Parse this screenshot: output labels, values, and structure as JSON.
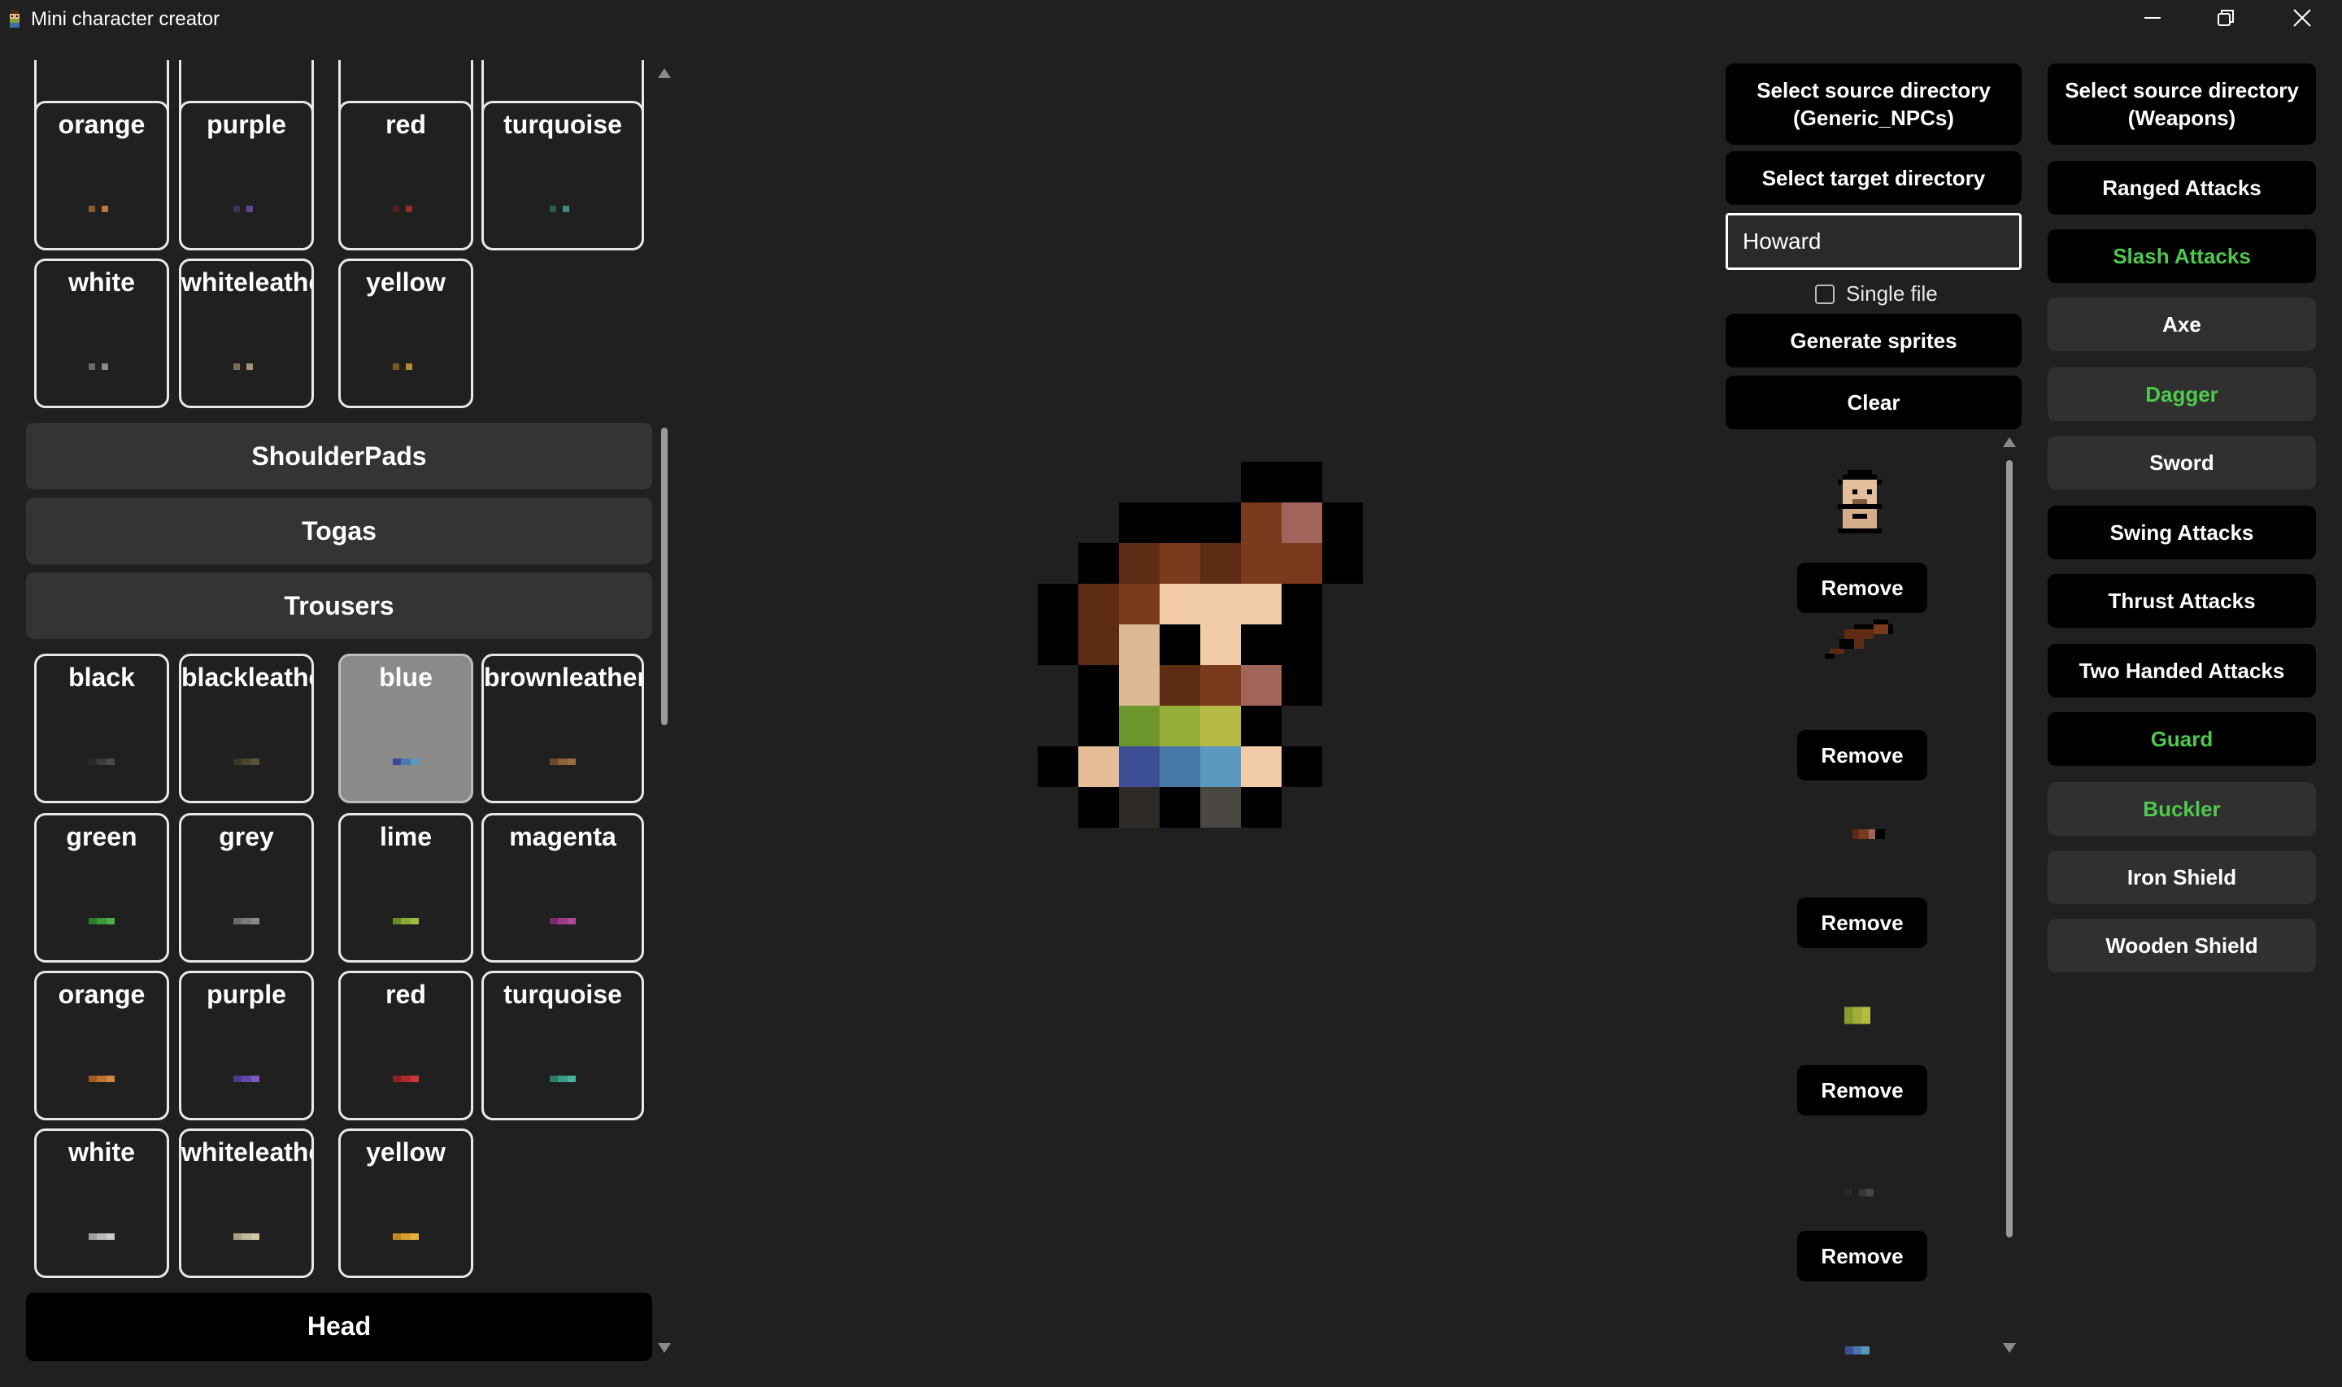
{
  "window": {
    "title": "Mini character creator",
    "controls": [
      "minimize-icon",
      "restore-icon",
      "close-icon"
    ]
  },
  "left_panel": {
    "top_color_rows": [
      [
        "orange",
        "purple",
        "red",
        "turquoise"
      ],
      [
        "white",
        "whiteleather",
        "yellow"
      ]
    ],
    "categories": [
      "ShoulderPads",
      "Togas",
      "Trousers"
    ],
    "trousers_colors": [
      [
        "black",
        "blackleather",
        "blue",
        "brownleather"
      ],
      [
        "green",
        "grey",
        "lime",
        "magenta"
      ],
      [
        "orange",
        "purple",
        "red",
        "turquoise"
      ],
      [
        "white",
        "whiteleather",
        "yellow"
      ]
    ],
    "selected_color": "blue",
    "bottom_category": "Head"
  },
  "middle_column": {
    "select_source_label": "Select source directory (Generic_NPCs)",
    "select_target_label": "Select target directory",
    "name_input_value": "Howard",
    "single_file_label": "Single file",
    "single_file_checked": false,
    "generate_label": "Generate sprites",
    "clear_label": "Clear",
    "remove_label": "Remove"
  },
  "right_column": {
    "select_source_weapons_label": "Select source directory (Weapons)",
    "buttons": [
      {
        "label": "Ranged Attacks",
        "style": "black"
      },
      {
        "label": "Slash Attacks",
        "style": "green-black"
      },
      {
        "label": "Axe",
        "style": "grey"
      },
      {
        "label": "Dagger",
        "style": "green-grey"
      },
      {
        "label": "Sword",
        "style": "grey"
      },
      {
        "label": "Swing Attacks",
        "style": "black"
      },
      {
        "label": "Thrust Attacks",
        "style": "black"
      },
      {
        "label": "Two Handed Attacks",
        "style": "black"
      },
      {
        "label": "Guard",
        "style": "green-black"
      },
      {
        "label": "Buckler",
        "style": "green-grey"
      },
      {
        "label": "Iron Shield",
        "style": "grey"
      },
      {
        "label": "Wooden Shield",
        "style": "grey"
      }
    ]
  },
  "colors": {
    "background": "#202020",
    "accent_green": "#4ec94e",
    "button_black": "#000000",
    "button_grey": "#303030"
  }
}
